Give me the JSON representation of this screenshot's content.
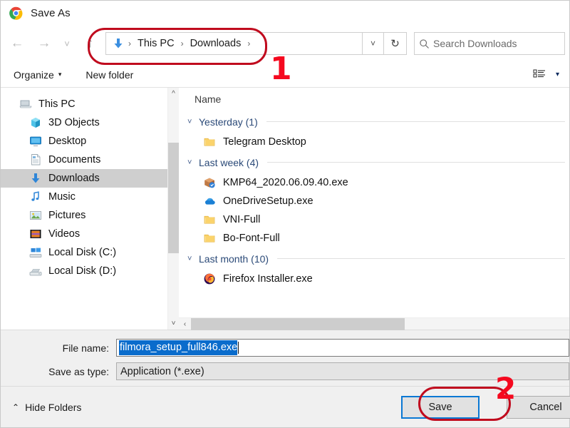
{
  "window": {
    "title": "Save As",
    "app_icon": "chrome-logo-icon"
  },
  "navbar": {
    "back_icon": "arrow-left-icon",
    "forward_icon": "arrow-right-icon",
    "recent_icon": "chevron-down-icon",
    "up_icon": "arrow-up-icon",
    "breadcrumb_icon": "downloads-arrow-icon",
    "breadcrumbs": [
      "This PC",
      "Downloads"
    ],
    "separator": "›",
    "address_dropdown_icon": "chevron-down-icon",
    "refresh_icon": "refresh-icon",
    "search": {
      "icon": "search-icon",
      "placeholder": "Search Downloads",
      "value": ""
    }
  },
  "commandbar": {
    "organize_label": "Organize",
    "organize_caret": "▾",
    "new_folder_label": "New folder",
    "view_icon": "list-view-icon",
    "view_caret": "▾"
  },
  "sidebar": {
    "items": [
      {
        "label": "This PC",
        "icon": "this-pc-icon",
        "selected": false,
        "indent": 0
      },
      {
        "label": "3D Objects",
        "icon": "3d-objects-icon",
        "selected": false,
        "indent": 1
      },
      {
        "label": "Desktop",
        "icon": "desktop-icon",
        "selected": false,
        "indent": 1
      },
      {
        "label": "Documents",
        "icon": "documents-icon",
        "selected": false,
        "indent": 1
      },
      {
        "label": "Downloads",
        "icon": "downloads-icon",
        "selected": true,
        "indent": 1
      },
      {
        "label": "Music",
        "icon": "music-icon",
        "selected": false,
        "indent": 1
      },
      {
        "label": "Pictures",
        "icon": "pictures-icon",
        "selected": false,
        "indent": 1
      },
      {
        "label": "Videos",
        "icon": "videos-icon",
        "selected": false,
        "indent": 1
      },
      {
        "label": "Local Disk (C:)",
        "icon": "windows-disk-icon",
        "selected": false,
        "indent": 1
      },
      {
        "label": "Local Disk (D:)",
        "icon": "disk-icon",
        "selected": false,
        "indent": 1
      }
    ],
    "scroll_up_icon": "chevron-up-icon",
    "scroll_down_icon": "chevron-down-icon"
  },
  "filelist": {
    "column_header": "Name",
    "groups": [
      {
        "label": "Yesterday (1)",
        "chevron": "⌄",
        "files": [
          {
            "name": "Telegram Desktop",
            "icon": "folder-icon"
          }
        ]
      },
      {
        "label": "Last week (4)",
        "chevron": "⌄",
        "files": [
          {
            "name": "KMP64_2020.06.09.40.exe",
            "icon": "package-exe-icon"
          },
          {
            "name": "OneDriveSetup.exe",
            "icon": "onedrive-icon"
          },
          {
            "name": "VNI-Full",
            "icon": "folder-icon"
          },
          {
            "name": "Bo-Font-Full",
            "icon": "folder-icon"
          }
        ]
      },
      {
        "label": "Last month (10)",
        "chevron": "⌄",
        "files": [
          {
            "name": "Firefox Installer.exe",
            "icon": "firefox-icon"
          }
        ]
      }
    ],
    "hscroll_left_icon": "chevron-left-icon"
  },
  "form": {
    "file_name_label": "File name:",
    "file_name_value": "filmora_setup_full846.exe",
    "save_as_type_label": "Save as type:",
    "save_as_type_value": "Application (*.exe)"
  },
  "footer": {
    "hide_folders_label": "Hide Folders",
    "hide_folders_chevron": "⌃",
    "save_label": "Save",
    "cancel_label": "Cancel"
  },
  "annotations": [
    {
      "id": "1",
      "label": "1",
      "target": "breadcrumb-bar"
    },
    {
      "id": "2",
      "label": "2",
      "target": "save-button"
    }
  ],
  "colors": {
    "annotation_outline": "#c00b1e",
    "annotation_number": "#f5091f",
    "selection_blue": "#0a6ccc",
    "focus_blue": "#0a78d4",
    "group_header": "#2b4a78"
  }
}
